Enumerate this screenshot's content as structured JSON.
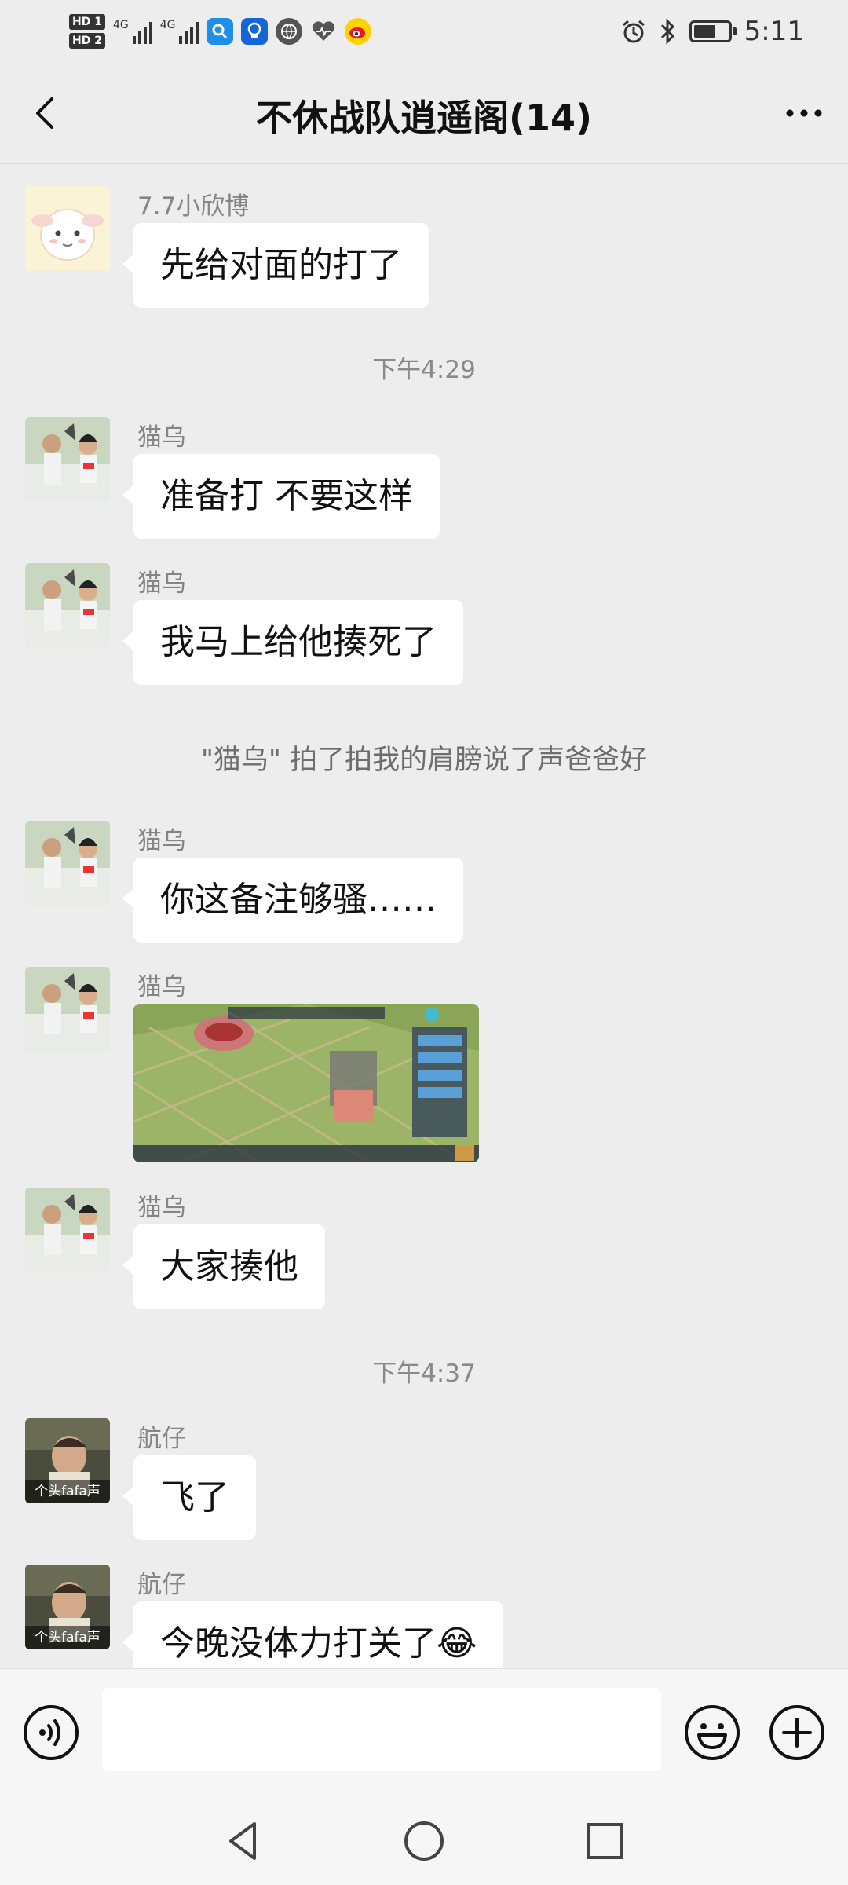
{
  "status_bar": {
    "sim1_tag": "HD 1",
    "sim2_tag": "HD 2",
    "net1": "4G",
    "net2": "4G",
    "battery_level": 0.75,
    "time": "5:11"
  },
  "nav": {
    "title": "不休战队逍遥阁(14)"
  },
  "messages": [
    {
      "sender": "7.7小欣博",
      "text": "先给对面的打了",
      "avatar": "lamb-avatar"
    },
    {
      "time": "下午4:29"
    },
    {
      "sender": "猫乌",
      "text": "准备打 不要这样",
      "avatar": "couple-avatar"
    },
    {
      "sender": "猫乌",
      "text": "我马上给他揍死了",
      "avatar": "couple-avatar"
    },
    {
      "system": "\"猫乌\" 拍了拍我的肩膀说了声爸爸好"
    },
    {
      "sender": "猫乌",
      "text": "你这备注够骚……",
      "avatar": "couple-avatar"
    },
    {
      "sender": "猫乌",
      "image": "game-screenshot",
      "avatar": "couple-avatar"
    },
    {
      "sender": "猫乌",
      "text": "大家揍他",
      "avatar": "couple-avatar"
    },
    {
      "time": "下午4:37"
    },
    {
      "sender": "航仔",
      "text": "飞了",
      "avatar": "photo-avatar",
      "avatar_caption": "个头fafa声"
    },
    {
      "sender": "航仔",
      "text": "今晚没体力打关了😂",
      "avatar": "photo-avatar",
      "avatar_caption": "个头fafa声"
    }
  ],
  "input": {
    "value": ""
  },
  "colors": {
    "background": "#ededed",
    "bubble": "#ffffff",
    "sender_name": "#858585"
  }
}
